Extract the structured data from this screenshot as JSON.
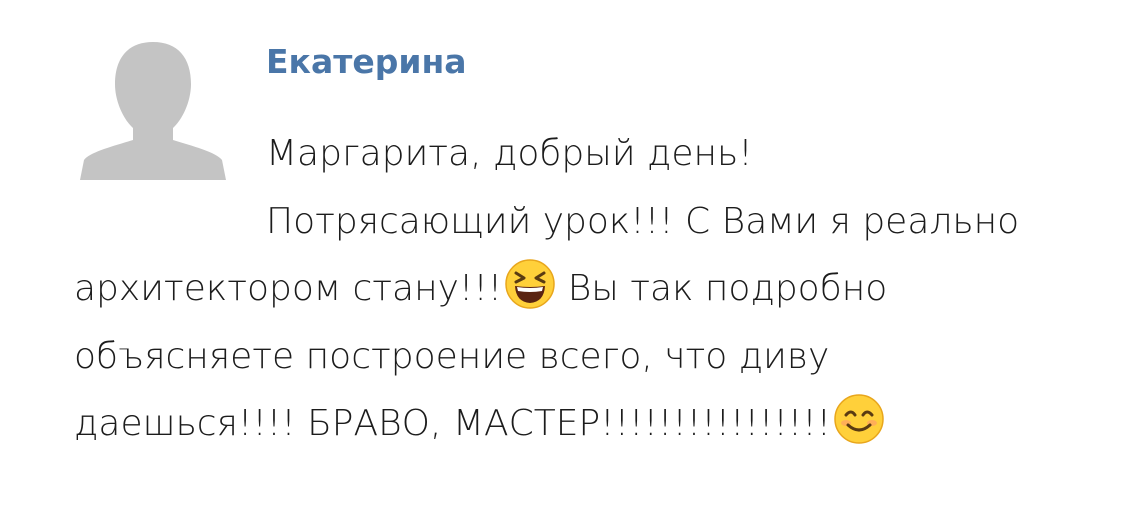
{
  "comment": {
    "author_name": "Екатерина",
    "avatar_icon": "default-user-silhouette-icon",
    "lines": [
      "Маргарита, добрый день!",
      "Потрясающий урок!!! С Вами я реально",
      "архитектором стану!!!",
      "Вы так подробно",
      "объясняете построение всего, что диву",
      "даешься!!!! БРАВО, МАСТЕР!!!!!!!!!!!!!!!!"
    ],
    "emojis": [
      "laughing-squinting-face-emoji",
      "smiling-face-emoji"
    ],
    "colors": {
      "author": "#4a76a8",
      "text": "#1c1c1c",
      "avatar": "#c4c4c4",
      "emoji_face": "#ffd03a"
    }
  }
}
